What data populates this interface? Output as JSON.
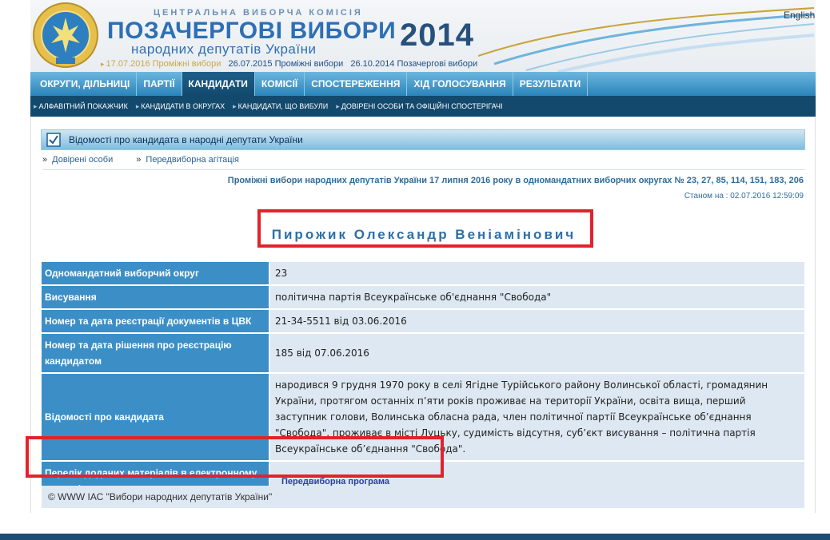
{
  "header": {
    "commission": "ЦЕНТРАЛЬНА ВИБОРЧА КОМІСІЯ",
    "title": "ПОЗАЧЕРГОВІ ВИБОРИ",
    "subtitle": "народних депутатів України",
    "year": "2014",
    "language_link": "English",
    "elections": [
      "17.07.2016 Проміжні вибори",
      "26.07.2015 Проміжні вибори",
      "26.10.2014 Позачергові вибори"
    ]
  },
  "nav": {
    "items": [
      "ОКРУГИ, ДІЛЬНИЦІ",
      "ПАРТІЇ",
      "КАНДИДАТИ",
      "КОМІСІЇ",
      "СПОСТЕРЕЖЕННЯ",
      "ХІД ГОЛОСУВАННЯ",
      "РЕЗУЛЬТАТИ"
    ],
    "active": "КАНДИДАТИ"
  },
  "subnav": {
    "items": [
      "АЛФАВІТНИЙ ПОКАЖЧИК",
      "КАНДИДАТИ В ОКРУГАХ",
      "КАНДИДАТИ, ЩО ВИБУЛИ",
      "ДОВІРЕНІ ОСОБИ ТА ОФІЦІЙНІ СПОСТЕРІГАЧІ"
    ]
  },
  "section": {
    "title": "Відомості про кандидата в народні депутати України",
    "links": [
      "Довірені особи",
      "Передвиборна агітація"
    ],
    "raquo": "»"
  },
  "election_title": "Проміжні вибори народних депутатів України 17 липня 2016 року в одномандатних виборчих округах № 23, 27, 85, 114, 151, 183, 206",
  "as_of": "Станом на : 02.07.2016 12:59:09",
  "candidate": {
    "name": "Пирожик Олександр Веніамінович",
    "rows": [
      {
        "label": "Одномандатний виборчий округ",
        "value": "23"
      },
      {
        "label": "Висування",
        "value": "політична партія Всеукраїнське об'єднання \"Свобода\""
      },
      {
        "label": "Номер та дата реєстрації документів в ЦВК",
        "value": "21-34-5511 від 03.06.2016"
      },
      {
        "label": "Номер та дата рішення про реєстрацію кандидатом",
        "value": "185 від 07.06.2016"
      },
      {
        "label": "Відомості про кандидата",
        "value": "народився 9 грудня 1970 року в селі Ягідне Турійського району Волинської області, громадянин України, протягом останніх п’яти років проживає на території України, освіта вища, перший заступник голови, Волинська обласна рада, член політичної партії Всеукраїнське об’єднання \"Свобода\", проживає в місті Луцьку, судимість відсутня, суб’єкт висування – політична партія Всеукраїнське об’єднання \"Свобода\"."
      },
      {
        "label": "Перелік доданих матеріалів в електронному вигляді",
        "value": "Передвиборна програма"
      }
    ]
  },
  "footer": "© WWW ІАС \"Вибори народних депутатів України\"",
  "colors": {
    "nav_blue": "#2a84ba",
    "subnav_dark": "#13496d",
    "label_blue": "#3b8fc6",
    "value_bg": "#dde8f2",
    "highlight_red": "#e0232c",
    "name_blue": "#2d6fa8"
  }
}
